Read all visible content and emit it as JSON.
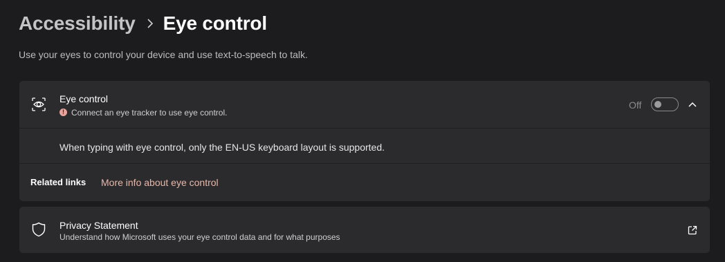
{
  "header": {
    "breadcrumb_parent": "Accessibility",
    "separator_icon": "chevron-right-icon",
    "breadcrumb_current": "Eye control",
    "subtitle": "Use your eyes to control your device and use text-to-speech to talk."
  },
  "eye_control_card": {
    "icon": "eye-control-icon",
    "title": "Eye control",
    "warning_icon": "warning-dot-icon",
    "warning_glyph": "!",
    "warning": "Connect an eye tracker to use eye control.",
    "toggle_state_label": "Off",
    "toggle_on": false,
    "expanded": true,
    "expand_icon": "chevron-up-icon",
    "note": "When typing with eye control, only the EN-US keyboard layout is supported.",
    "related_links_label": "Related links",
    "related_link": "More info about eye control"
  },
  "privacy_card": {
    "icon": "shield-icon",
    "title": "Privacy Statement",
    "description": "Understand how Microsoft uses your eye control data and for what purposes",
    "link_icon": "external-link-icon"
  },
  "colors": {
    "background": "#1c1c1f",
    "card": "#2b2b2d",
    "link_accent": "#e8b7a9",
    "warning": "#e8a49c"
  }
}
